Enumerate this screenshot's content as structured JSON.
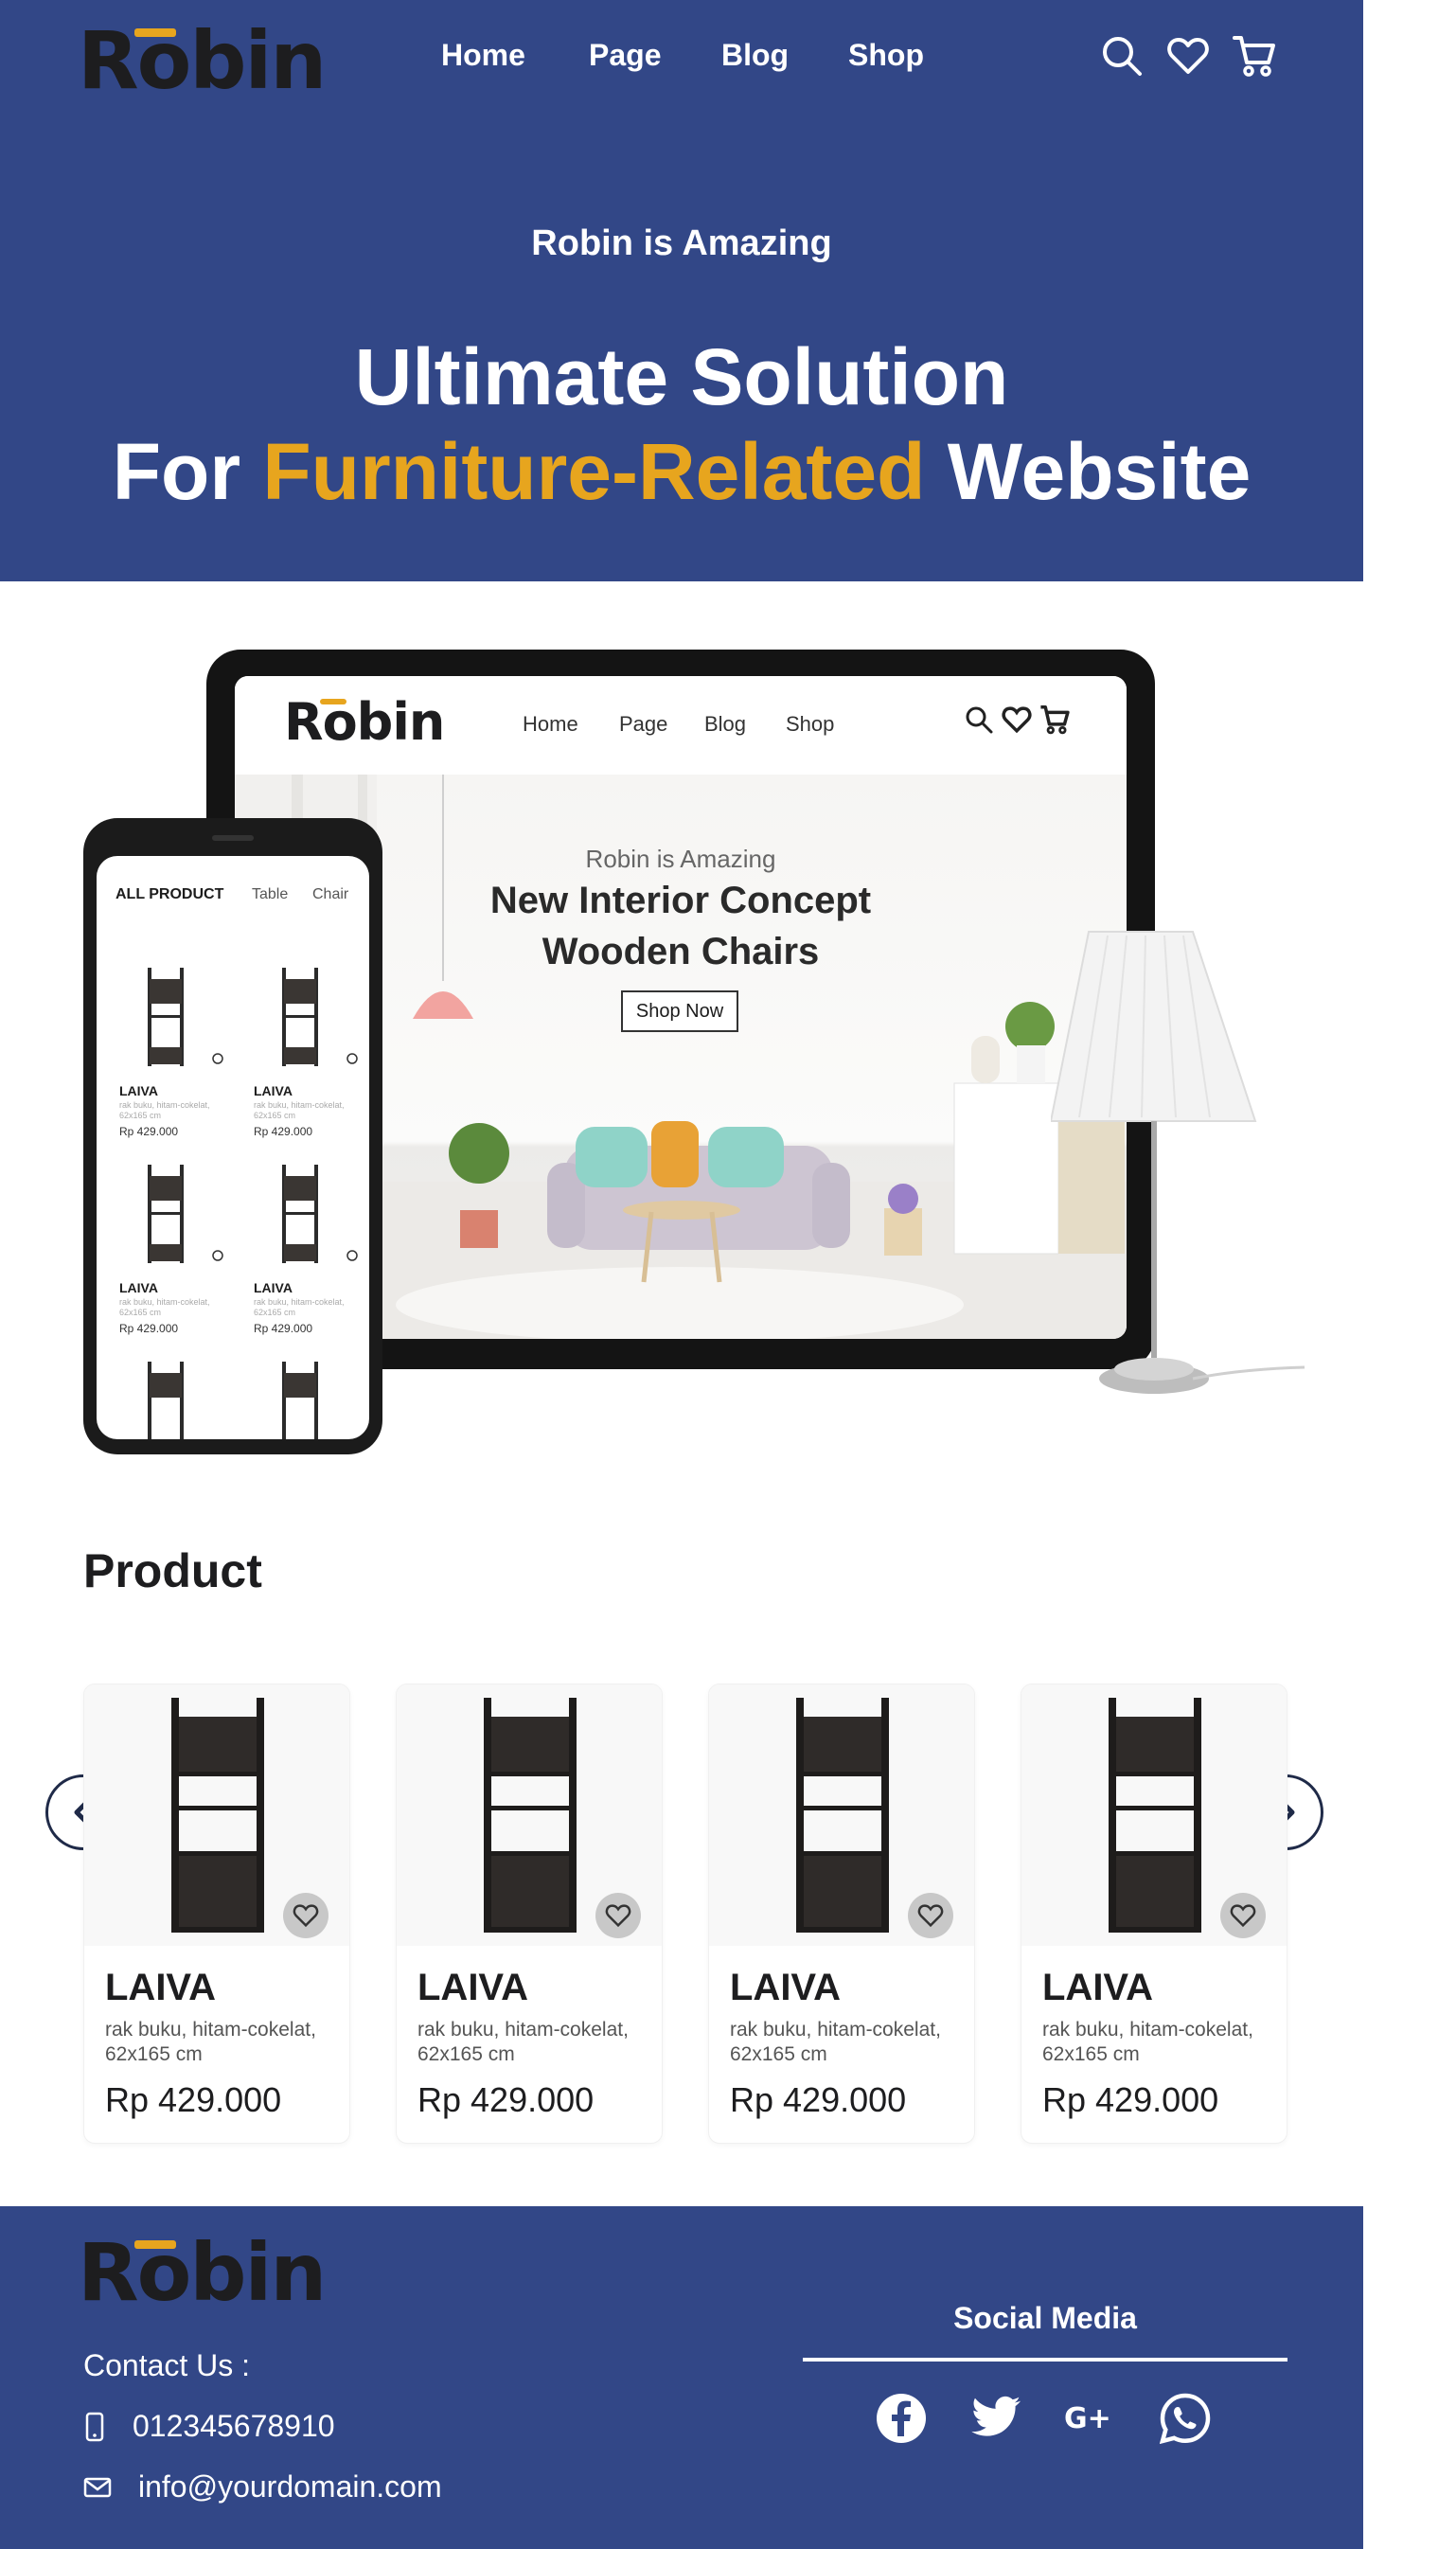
{
  "brand": {
    "logo_text": "Robin",
    "accent_color": "#e7a51e",
    "primary_color": "#324787"
  },
  "header": {
    "nav": [
      "Home",
      "Page",
      "Blog",
      "Shop"
    ],
    "icons": [
      "search-icon",
      "heart-icon",
      "cart-icon"
    ]
  },
  "hero": {
    "kicker": "Robin is Amazing",
    "title_line1": "Ultimate Solution",
    "title_line2_prefix": "For ",
    "title_line2_accent": "Furniture-Related",
    "title_line2_suffix": " Website"
  },
  "mockup": {
    "tablet": {
      "logo": "Robin",
      "nav": [
        "Home",
        "Page",
        "Blog",
        "Shop"
      ],
      "kicker": "Robin is Amazing",
      "title_line1": "New Interior Concept",
      "title_line2": "Wooden Chairs",
      "button": "Shop Now"
    },
    "phone": {
      "tabs": [
        "ALL PRODUCT",
        "Table",
        "Chair"
      ],
      "products": [
        {
          "name": "LAIVA",
          "desc": "rak buku, hitam-cokelat, 62x165 cm",
          "price": "Rp 429.000"
        },
        {
          "name": "LAIVA",
          "desc": "rak buku, hitam-cokelat, 62x165 cm",
          "price": "Rp 429.000"
        },
        {
          "name": "LAIVA",
          "desc": "rak buku, hitam-cokelat, 62x165 cm",
          "price": "Rp 429.000"
        },
        {
          "name": "LAIVA",
          "desc": "rak buku, hitam-cokelat, 62x165 cm",
          "price": "Rp 429.000"
        }
      ]
    }
  },
  "products": {
    "title": "Product",
    "items": [
      {
        "name": "LAIVA",
        "desc": "rak buku, hitam-cokelat, 62x165 cm",
        "price": "Rp 429.000"
      },
      {
        "name": "LAIVA",
        "desc": "rak buku, hitam-cokelat, 62x165 cm",
        "price": "Rp 429.000"
      },
      {
        "name": "LAIVA",
        "desc": "rak buku, hitam-cokelat, 62x165 cm",
        "price": "Rp 429.000"
      },
      {
        "name": "LAIVA",
        "desc": "rak buku, hitam-cokelat, 62x165 cm",
        "price": "Rp 429.000"
      }
    ]
  },
  "footer": {
    "logo": "Robin",
    "contact_title": "Contact Us :",
    "phone": "012345678910",
    "email": "info@yourdomain.com",
    "social_title": "Social Media",
    "social_icons": [
      "facebook-icon",
      "twitter-icon",
      "google-plus-icon",
      "whatsapp-icon"
    ]
  }
}
